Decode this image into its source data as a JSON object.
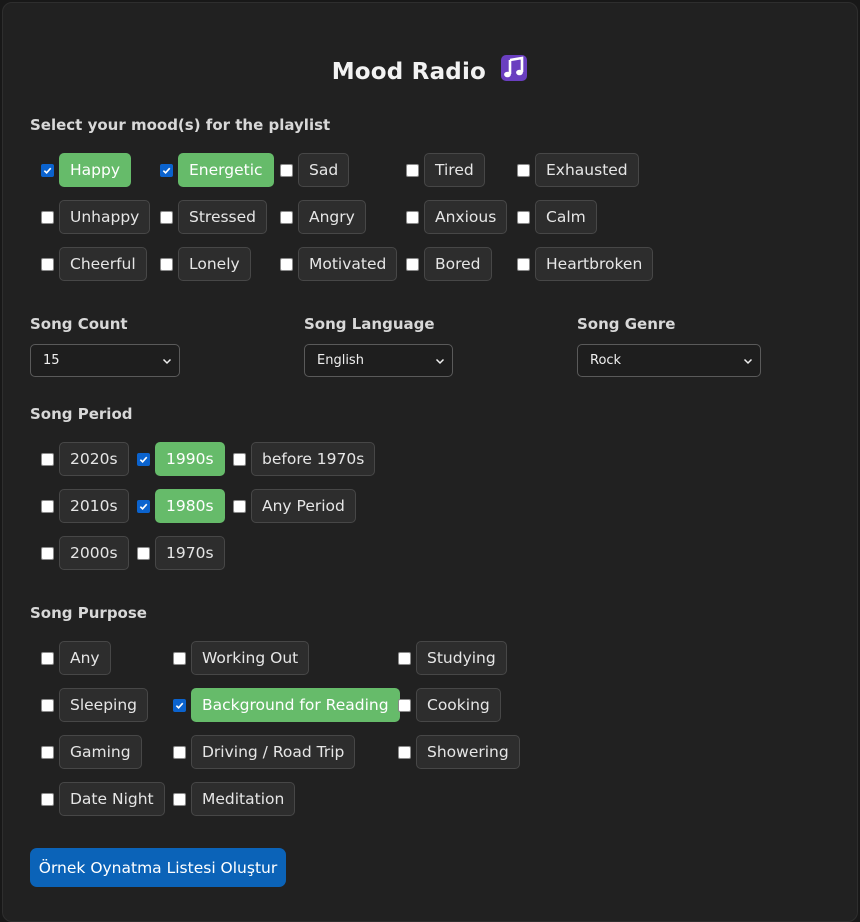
{
  "app": {
    "title": "Mood Radio",
    "title_icon": "music-note-icon"
  },
  "colors": {
    "panel_bg": "#212121",
    "selected_chip": "#66bb6a",
    "checkbox_checked": "#0b63ce",
    "button": "#0b63b8"
  },
  "moods": {
    "label": "Select your mood(s) for the playlist",
    "items": [
      {
        "label": "Happy",
        "checked": true
      },
      {
        "label": "Energetic",
        "checked": true
      },
      {
        "label": "Sad",
        "checked": false
      },
      {
        "label": "Tired",
        "checked": false
      },
      {
        "label": "Exhausted",
        "checked": false
      },
      {
        "label": "Unhappy",
        "checked": false
      },
      {
        "label": "Stressed",
        "checked": false
      },
      {
        "label": "Angry",
        "checked": false
      },
      {
        "label": "Anxious",
        "checked": false
      },
      {
        "label": "Calm",
        "checked": false
      },
      {
        "label": "Cheerful",
        "checked": false
      },
      {
        "label": "Lonely",
        "checked": false
      },
      {
        "label": "Motivated",
        "checked": false
      },
      {
        "label": "Bored",
        "checked": false
      },
      {
        "label": "Heartbroken",
        "checked": false
      }
    ]
  },
  "song_count": {
    "label": "Song Count",
    "value": "15"
  },
  "song_language": {
    "label": "Song Language",
    "value": "English"
  },
  "song_genre": {
    "label": "Song Genre",
    "value": "Rock"
  },
  "period": {
    "label": "Song Period",
    "items": [
      {
        "label": "2020s",
        "checked": false
      },
      {
        "label": "1990s",
        "checked": true
      },
      {
        "label": "before 1970s",
        "checked": false
      },
      {
        "label": "2010s",
        "checked": false
      },
      {
        "label": "1980s",
        "checked": true
      },
      {
        "label": "Any Period",
        "checked": false
      },
      {
        "label": "2000s",
        "checked": false
      },
      {
        "label": "1970s",
        "checked": false
      }
    ]
  },
  "purpose": {
    "label": "Song Purpose",
    "items": [
      {
        "label": "Any",
        "checked": false
      },
      {
        "label": "Working Out",
        "checked": false
      },
      {
        "label": "Studying",
        "checked": false
      },
      {
        "label": "Sleeping",
        "checked": false
      },
      {
        "label": "Background for Reading",
        "checked": true
      },
      {
        "label": "Cooking",
        "checked": false
      },
      {
        "label": "Gaming",
        "checked": false
      },
      {
        "label": "Driving / Road Trip",
        "checked": false
      },
      {
        "label": "Showering",
        "checked": false
      },
      {
        "label": "Date Night",
        "checked": false
      },
      {
        "label": "Meditation",
        "checked": false
      }
    ]
  },
  "generate_button": {
    "label": "Örnek Oynatma Listesi Oluştur"
  }
}
